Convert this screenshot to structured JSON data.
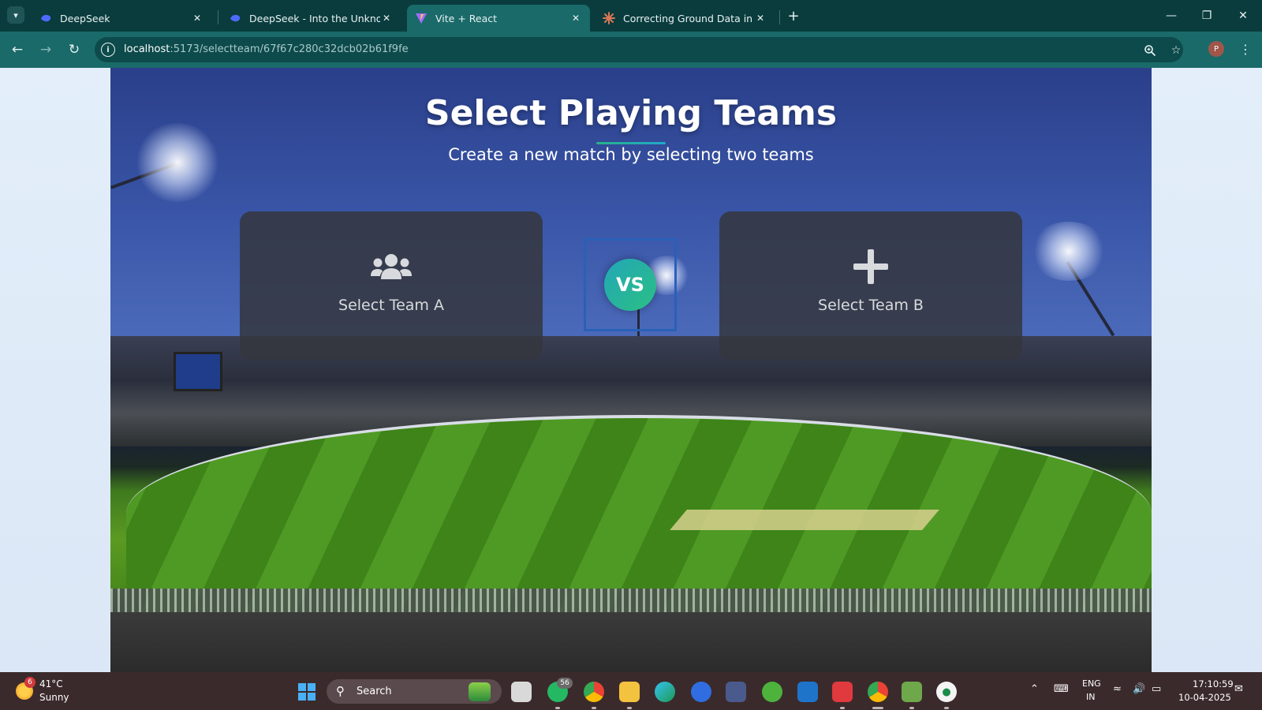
{
  "browser": {
    "tabs": [
      {
        "title": "DeepSeek",
        "icon": "deepseek-whale-icon",
        "active": false
      },
      {
        "title": "DeepSeek - Into the Unknown",
        "icon": "deepseek-whale-icon",
        "active": false
      },
      {
        "title": "Vite + React",
        "icon": "vite-logo-icon",
        "active": true
      },
      {
        "title": "Correcting Ground Data in Cricl",
        "icon": "claude-starburst-icon",
        "active": false
      }
    ],
    "close_glyph": "✕",
    "new_tab_glyph": "+",
    "window_controls": {
      "minimize": "—",
      "restore": "❐",
      "close": "✕"
    },
    "url_host": "localhost",
    "url_path": ":5173/selectteam/67f67c280c32dcb02b61f9fe",
    "profile_initial": "P"
  },
  "page": {
    "title": "Select Playing Teams",
    "subtitle": "Create a new match by selecting two teams",
    "team_a_label": "Select Team A",
    "team_b_label": "Select Team B",
    "vs_label": "VS",
    "accent_colors": {
      "teal": "#27b38a",
      "blue": "#22a7c9"
    }
  },
  "taskbar": {
    "weather_badge": "6",
    "weather_temp": "41°C",
    "weather_condition": "Sunny",
    "search_label": "Search",
    "whatsapp_badge": "56",
    "language_line1": "ENG",
    "language_line2": "IN",
    "time": "17:10:59",
    "date": "10-04-2025"
  }
}
